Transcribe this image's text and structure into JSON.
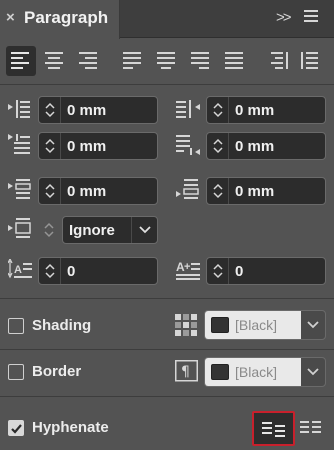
{
  "panel": {
    "title": "Paragraph",
    "close_glyph": "×",
    "collapse_glyph": ">>",
    "menu_icon": "hamburger-menu-icon"
  },
  "alignment": {
    "buttons": [
      {
        "name": "align-left",
        "active": true
      },
      {
        "name": "align-center",
        "active": false
      },
      {
        "name": "align-right",
        "active": false
      },
      {
        "name": "justify-last-left",
        "active": false
      },
      {
        "name": "justify-last-center",
        "active": false
      },
      {
        "name": "justify-last-right",
        "active": false
      },
      {
        "name": "justify-all",
        "active": false
      },
      {
        "name": "align-towards-spine",
        "active": false
      },
      {
        "name": "align-away-from-spine",
        "active": false
      }
    ]
  },
  "indents": {
    "left_indent": "0 mm",
    "right_indent": "0 mm",
    "first_line_indent": "0 mm",
    "last_line_right_indent": "0 mm"
  },
  "spacing": {
    "space_before": "0 mm",
    "space_after": "0 mm",
    "space_between": "Ignore"
  },
  "dropcap": {
    "lines": "0",
    "characters": "0"
  },
  "shading": {
    "label": "Shading",
    "checked": false,
    "color": "[Black]"
  },
  "border": {
    "label": "Border",
    "checked": false,
    "color": "[Black]"
  },
  "hyphenate": {
    "label": "Hyphenate",
    "checked": true
  },
  "colors": {
    "panel_bg": "#535353",
    "field_bg": "#2c2c2c",
    "highlight": "#c8202c"
  }
}
